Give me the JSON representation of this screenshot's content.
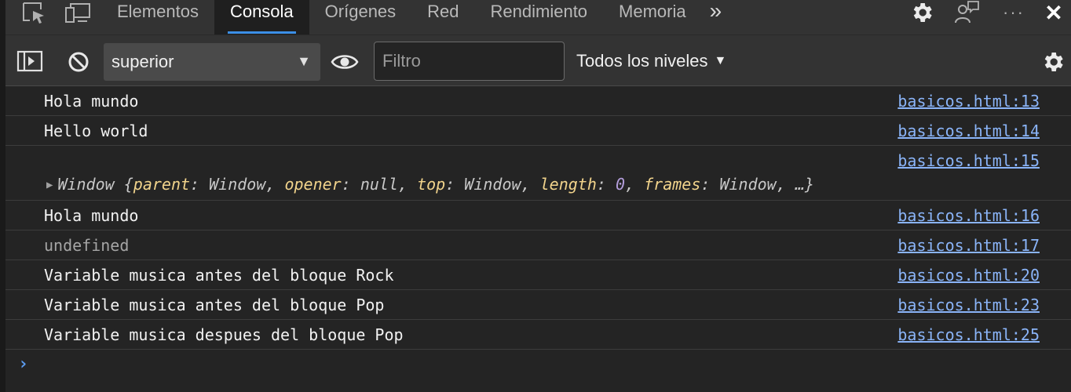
{
  "tabbar": {
    "tabs": [
      {
        "label": "Elementos",
        "active": false
      },
      {
        "label": "Consola",
        "active": true
      },
      {
        "label": "Orígenes",
        "active": false
      },
      {
        "label": "Red",
        "active": false
      },
      {
        "label": "Rendimiento",
        "active": false
      },
      {
        "label": "Memoria",
        "active": false
      }
    ],
    "more_tabs": "»",
    "more_menu": "···",
    "close": "✕"
  },
  "toolbar": {
    "context": "superior",
    "filter_placeholder": "Filtro",
    "filter_value": "",
    "levels": "Todos los niveles"
  },
  "console": {
    "rows": [
      {
        "text": "Hola mundo",
        "source": "basicos.html:13"
      },
      {
        "text": "Hello world",
        "source": "basicos.html:14"
      },
      {
        "source": "basicos.html:15",
        "object": {
          "class": "Window",
          "props": [
            {
              "key": "parent",
              "value": "Window"
            },
            {
              "key": "opener",
              "value": "null"
            },
            {
              "key": "top",
              "value": "Window"
            },
            {
              "key": "length",
              "value": "0"
            },
            {
              "key": "frames",
              "value": "Window"
            }
          ],
          "ellipsis": "…"
        }
      },
      {
        "text": "Hola mundo",
        "source": "basicos.html:16"
      },
      {
        "text": "undefined",
        "source": "basicos.html:17"
      },
      {
        "text": "Variable musica antes del bloque Rock",
        "source": "basicos.html:20"
      },
      {
        "text": "Variable musica antes del bloque Pop",
        "source": "basicos.html:23"
      },
      {
        "text": "Variable musica despues del bloque Pop",
        "source": "basicos.html:25"
      }
    ],
    "prompt": "›"
  },
  "colors": {
    "accent": "#3c8fe6",
    "link": "#8ab4f8",
    "object_key": "#f2d48c",
    "number": "#b39ddb"
  }
}
